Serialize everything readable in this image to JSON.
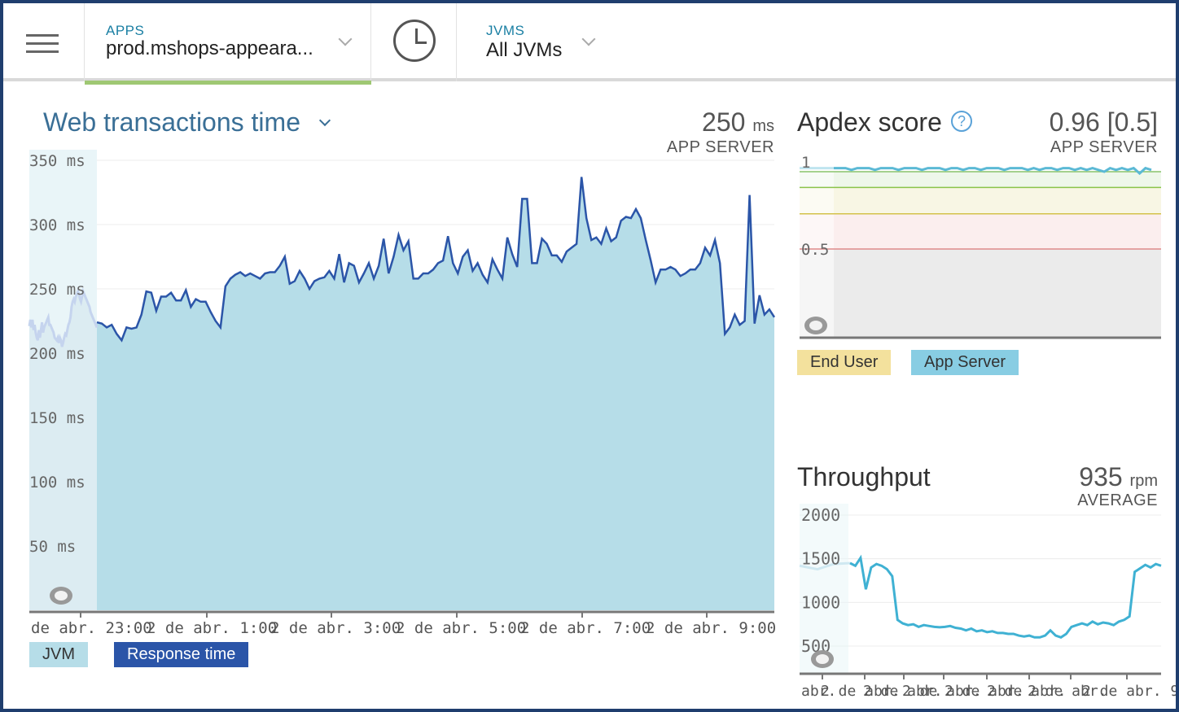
{
  "header": {
    "apps_label": "APPS",
    "app_name": "prod.mshops-appeara...",
    "jvms_label": "JVMS",
    "jvms_value": "All JVMs"
  },
  "icons": [
    "menu-icon",
    "chevron-down-icon",
    "clock-icon",
    "help-icon",
    "eye-icon"
  ],
  "colors": {
    "accent_blue": "#2b55a8",
    "area_fill": "#b6dde8",
    "throughput_line": "#3fb1d3",
    "apps_underline": "#9fc873",
    "end_user_legend": "#f3e19d",
    "app_server_legend": "#88cde3"
  },
  "web_transactions": {
    "title": "Web transactions time",
    "value": "250",
    "unit": "ms",
    "sublabel": "APP SERVER",
    "legend": [
      "JVM",
      "Response time"
    ]
  },
  "apdex": {
    "title": "Apdex score",
    "value": "0.96 [0.5]",
    "sublabel": "APP SERVER",
    "legend": [
      "End User",
      "App Server"
    ]
  },
  "throughput": {
    "title": "Throughput",
    "value": "935",
    "unit": "rpm",
    "sublabel": "AVERAGE"
  },
  "chart_data": [
    {
      "type": "area",
      "title": "Web transactions time",
      "series": [
        {
          "name": "JVM",
          "values": [
            221,
            226,
            220,
            226,
            218,
            222,
            216,
            212,
            210,
            218,
            212,
            218,
            224,
            216,
            220,
            222,
            224,
            226,
            228,
            222,
            222,
            220,
            218,
            216,
            212,
            211,
            210,
            212,
            208,
            212,
            210,
            205,
            208,
            212,
            215,
            214,
            218,
            222,
            224,
            228,
            236,
            240,
            242,
            240,
            244,
            246,
            248,
            246,
            242,
            240,
            244,
            248,
            246,
            244,
            242,
            240,
            238,
            236,
            232,
            230,
            228,
            226,
            224,
            222,
            220
          ]
        },
        {
          "name": "Response time",
          "values": [
            224,
            223,
            220,
            222,
            215,
            210,
            220,
            219,
            220,
            230,
            248,
            247,
            233,
            244,
            244,
            247,
            241,
            241,
            249,
            236,
            242,
            240,
            240,
            232,
            225,
            220,
            252,
            258,
            261,
            263,
            260,
            262,
            260,
            258,
            262,
            263,
            263,
            268,
            275,
            254,
            256,
            264,
            258,
            250,
            256,
            258,
            259,
            264,
            258,
            277,
            255,
            270,
            268,
            255,
            262,
            270,
            258,
            268,
            289,
            262,
            275,
            292,
            280,
            287,
            258,
            258,
            262,
            262,
            265,
            270,
            272,
            291,
            270,
            262,
            275,
            280,
            264,
            270,
            261,
            255,
            273,
            265,
            258,
            290,
            277,
            267,
            320,
            320,
            270,
            270,
            289,
            285,
            276,
            276,
            271,
            279,
            282,
            285,
            337,
            305,
            288,
            290,
            285,
            297,
            287,
            290,
            303,
            306,
            305,
            312,
            305,
            288,
            272,
            255,
            265,
            265,
            267,
            265,
            260,
            262,
            265,
            265,
            270,
            282,
            276,
            288,
            270,
            215,
            220,
            230,
            222,
            225,
            323,
            223,
            245,
            230,
            234,
            228
          ]
        }
      ],
      "x_tick_labels": [
        "de abr. 23:00",
        "2 de abr. 1:00",
        "2 de abr. 3:00",
        "2 de abr. 5:00",
        "2 de abr. 7:00",
        "2 de abr. 9:00"
      ],
      "y_tick_labels": [
        "350 ms",
        "300 ms",
        "250 ms",
        "200 ms",
        "150 ms",
        "100 ms",
        "50 ms"
      ],
      "ylim": [
        0,
        350
      ]
    },
    {
      "type": "line",
      "title": "Apdex score",
      "series": [
        {
          "name": "App Server",
          "values": [
            0.96,
            0.96,
            0.96,
            0.95,
            0.96,
            0.96,
            0.96,
            0.95,
            0.96,
            0.96,
            0.96,
            0.95,
            0.96,
            0.96,
            0.96,
            0.95,
            0.96,
            0.96,
            0.96,
            0.95,
            0.96,
            0.96,
            0.95,
            0.96,
            0.96,
            0.95,
            0.96,
            0.96,
            0.96,
            0.95,
            0.96,
            0.96,
            0.96,
            0.95,
            0.96,
            0.95,
            0.96,
            0.96,
            0.95,
            0.96,
            0.96,
            0.95,
            0.96,
            0.95,
            0.96,
            0.95,
            0.94,
            0.96,
            0.95,
            0.96,
            0.95,
            0.96,
            0.93,
            0.96,
            0.95
          ]
        }
      ],
      "y_tick_labels": [
        "1",
        "0.5"
      ],
      "ylim": [
        0,
        1
      ]
    },
    {
      "type": "line",
      "title": "Throughput",
      "series": [
        {
          "name": "Throughput",
          "values": [
            1450,
            1420,
            1510,
            1150,
            1400,
            1440,
            1420,
            1380,
            1300,
            800,
            760,
            740,
            750,
            720,
            740,
            730,
            720,
            715,
            720,
            730,
            710,
            700,
            680,
            700,
            670,
            680,
            660,
            670,
            650,
            650,
            640,
            640,
            620,
            610,
            620,
            600,
            600,
            620,
            680,
            620,
            600,
            640,
            720,
            740,
            760,
            740,
            780,
            750,
            770,
            760,
            740,
            780,
            800,
            840,
            1350,
            1390,
            1430,
            1400,
            1440,
            1420
          ]
        }
      ],
      "y_tick_labels": [
        "2000",
        "1500",
        "1000",
        "500"
      ],
      "x_tick_labels": [
        "abr.",
        "2 de abr.",
        "2 de abr.",
        "2 de abr.",
        "2 de abr.",
        "2 de abr.",
        "2 de abr.",
        "2 de abr. 9:"
      ],
      "ylim": [
        0,
        2000
      ]
    }
  ]
}
